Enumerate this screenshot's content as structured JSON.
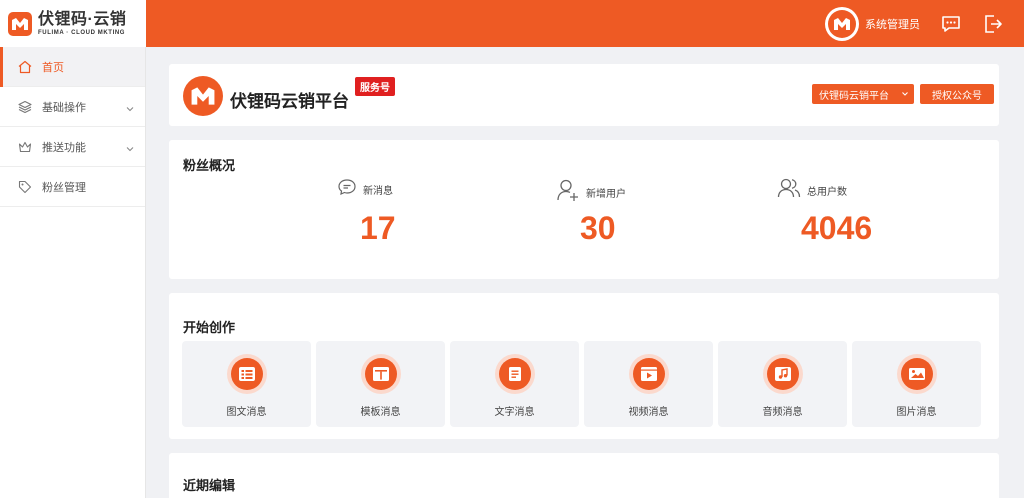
{
  "brand": {
    "name": "伏锂码·云销",
    "subtitle": "FULIMA · CLOUD MKTING",
    "accent_color": "#ee5a24"
  },
  "topbar": {
    "user_name": "系统管理员",
    "icons": [
      "user-avatar-logo",
      "message-icon",
      "logout-icon"
    ]
  },
  "sidebar": {
    "items": [
      {
        "label": "首页",
        "icon": "home-icon",
        "active": true,
        "has_submenu": false
      },
      {
        "label": "基础操作",
        "icon": "layers-icon",
        "active": false,
        "has_submenu": true
      },
      {
        "label": "推送功能",
        "icon": "crown-icon",
        "active": false,
        "has_submenu": true
      },
      {
        "label": "粉丝管理",
        "icon": "tag-icon",
        "active": false,
        "has_submenu": false
      }
    ]
  },
  "account": {
    "name": "伏锂码云销平台",
    "badge": "服务号",
    "select_value": "伏锂码云销平台",
    "auth_button": "授权公众号"
  },
  "fans": {
    "title": "粉丝概况",
    "stats": [
      {
        "label": "新消息",
        "value": "17",
        "icon": "chat-bubble-icon"
      },
      {
        "label": "新增用户",
        "value": "30",
        "icon": "add-user-icon"
      },
      {
        "label": "总用户数",
        "value": "4046",
        "icon": "users-icon"
      }
    ]
  },
  "create": {
    "title": "开始创作",
    "tiles": [
      {
        "label": "图文消息",
        "icon": "article-list-icon"
      },
      {
        "label": "模板消息",
        "icon": "template-icon"
      },
      {
        "label": "文字消息",
        "icon": "text-doc-icon"
      },
      {
        "label": "视频消息",
        "icon": "video-icon"
      },
      {
        "label": "音频消息",
        "icon": "music-icon"
      },
      {
        "label": "图片消息",
        "icon": "image-icon"
      }
    ]
  },
  "recent": {
    "title": "近期编辑"
  }
}
